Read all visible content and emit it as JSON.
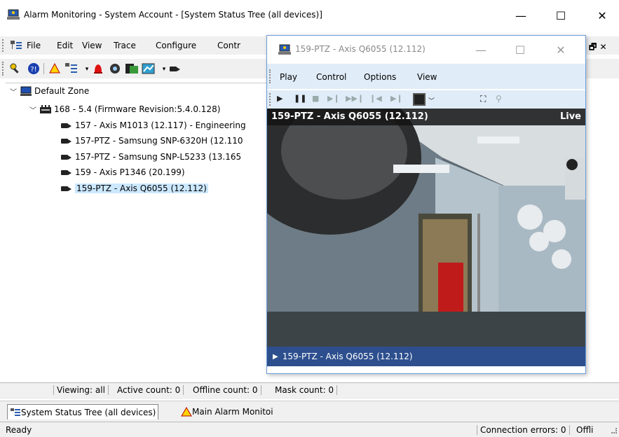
{
  "main": {
    "title": "Alarm Monitoring - System Account - [System Status Tree (all devices)]",
    "min_glyph": "—",
    "max_glyph": "☐",
    "close_glyph": "✕",
    "mdi_glyph": "🗗 ✕",
    "menu": [
      "File",
      "Edit",
      "View",
      "Trace",
      "Configure",
      "Contr"
    ]
  },
  "tree": {
    "root": "Default Zone",
    "panel": "168 - 5.4 (Firmware Revision:5.4.0.128)",
    "cameras": [
      "157 - Axis M1013 (12.117) - Engineering",
      "157-PTZ - Samsung SNP-6320H (12.110",
      "157-PTZ - Samsung SNP-L5233 (13.165",
      "159 - Axis P1346 (20.199)",
      "159-PTZ - Axis Q6055 (12.112)"
    ]
  },
  "status": {
    "viewing": "Viewing: all",
    "active": "Active count: 0",
    "offline": "Offline count: 0",
    "mask": "Mask count: 0"
  },
  "tabs": {
    "tree_tab": "System Status Tree (all devices)",
    "alarm_tab": "Main Alarm Monitoi"
  },
  "bottom": {
    "ready": "Ready",
    "conn_errors": "Connection errors: 0",
    "offline_short": "Offli"
  },
  "video": {
    "title": "159-PTZ - Axis Q6055 (12.112)",
    "menu": [
      "Play",
      "Control",
      "Options",
      "View"
    ],
    "overlay_title": "159-PTZ - Axis Q6055 (12.112)",
    "live": "Live",
    "caption": "159-PTZ - Axis Q6055 (12.112)"
  }
}
